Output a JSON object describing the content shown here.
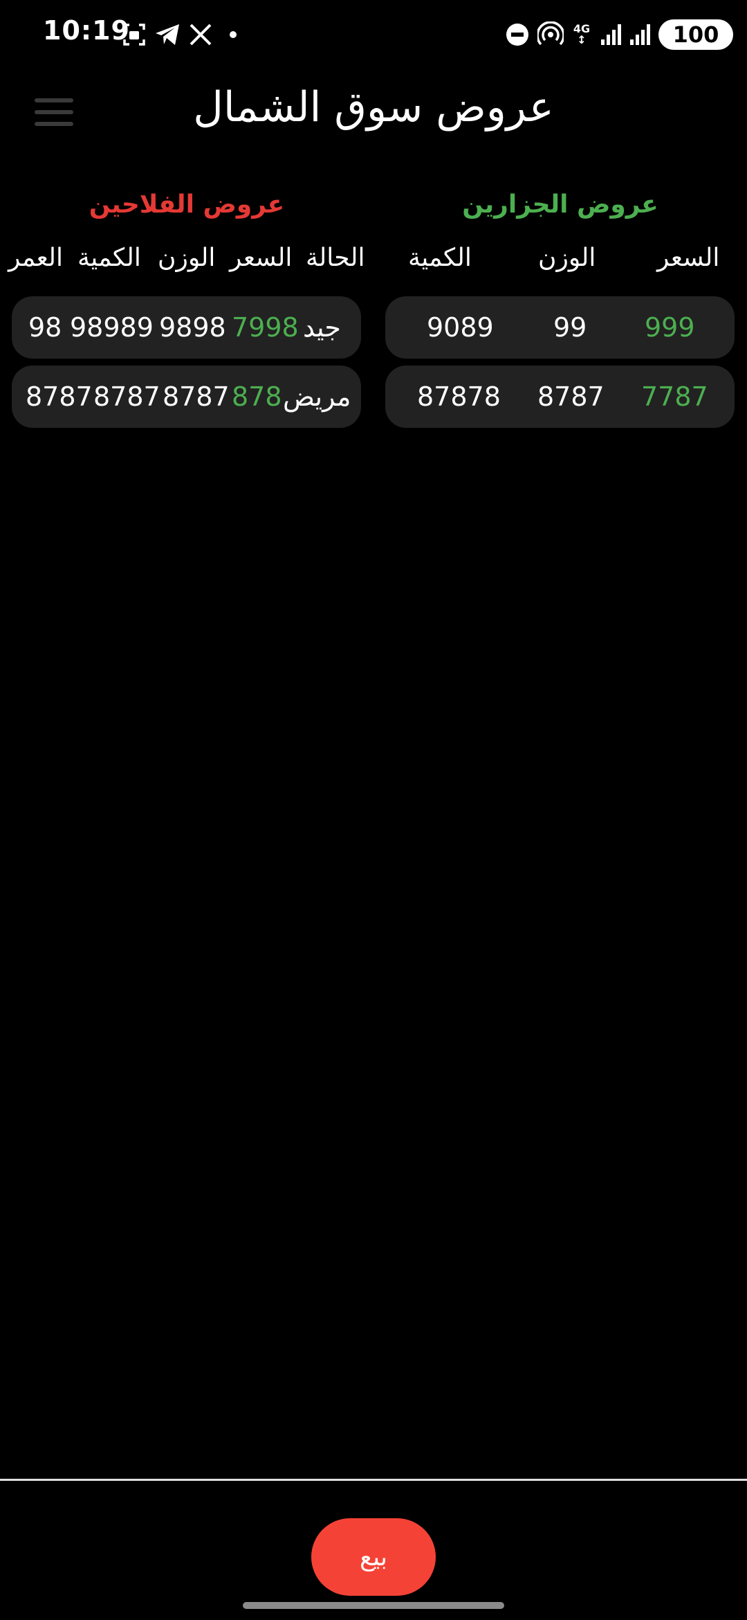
{
  "status_bar": {
    "time": "10:19",
    "network": "4G",
    "battery": "100",
    "icons": [
      "screenshot-icon",
      "telegram-icon",
      "x-icon",
      "dot-icon",
      "dnd-icon",
      "hotspot-icon",
      "signal-icon",
      "signal-icon"
    ]
  },
  "header": {
    "title": "عروض  سوق الشمال"
  },
  "butchers": {
    "title": "عروض الجزارين",
    "columns": {
      "price": "السعر",
      "weight": "الوزن",
      "quantity": "الكمية"
    },
    "rows": [
      {
        "price": "999",
        "weight": "99",
        "quantity": "9089"
      },
      {
        "price": "7787",
        "weight": "8787",
        "quantity": "87878"
      }
    ]
  },
  "farmers": {
    "title": "عروض الفلاحين",
    "columns": {
      "condition": "الحالة",
      "price": "السعر",
      "weight": "الوزن",
      "quantity": "الكمية",
      "age": "العمر"
    },
    "rows": [
      {
        "condition": "جيد",
        "price": "7998",
        "weight": "9898",
        "quantity": "98989",
        "age": "98"
      },
      {
        "condition": "مريض",
        "price": "878",
        "weight": "8787",
        "quantity": "8787",
        "age": "8787"
      }
    ]
  },
  "bottom": {
    "sell_label": "بيع"
  },
  "colors": {
    "accent_green": "#4caf50",
    "accent_red": "#e53935",
    "button_red": "#f44336",
    "card_bg": "#222222"
  }
}
